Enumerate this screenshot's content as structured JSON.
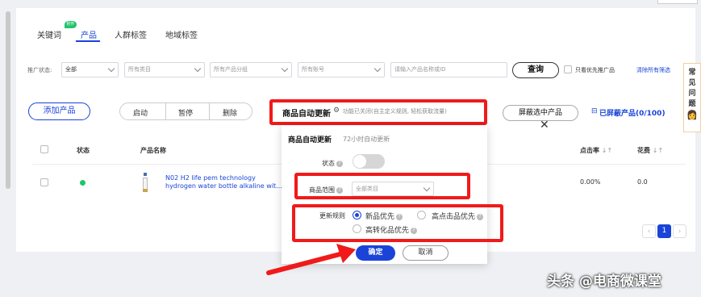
{
  "tabs": [
    {
      "label": "关键词",
      "badge": "附件"
    },
    {
      "label": "产品",
      "active": true
    },
    {
      "label": "人群标签"
    },
    {
      "label": "地域标签"
    }
  ],
  "filters": {
    "status_label": "推广状态:",
    "status_value": "全部",
    "category_placeholder": "所有类目",
    "group_placeholder": "所有产品分组",
    "account_placeholder": "所有账号",
    "search_placeholder": "请输入产品名称或ID",
    "query_button": "查询",
    "priority_only": "只看优先推广品",
    "clear_all": "清除所有筛选"
  },
  "toolbar": {
    "add_product": "添加产品",
    "start": "启动",
    "pause": "暂停",
    "delete": "删除",
    "auto_update_title": "商品自动更新",
    "auto_update_desc": "功能已关闭(自主定义规则, 轻松获取流量)",
    "hide_selected": "屏蔽选中产品",
    "hidden_count": "已屏蔽产品(0/100)"
  },
  "table": {
    "headers": {
      "status": "状态",
      "name": "产品名称",
      "ctr": "点击率",
      "cost": "花费"
    },
    "rows": [
      {
        "name_line1": "N02 H2 life pem technology",
        "name_line2": "hydrogen water bottle alkaline wit...",
        "ctr": "0.00%",
        "cost": "0.0"
      }
    ]
  },
  "popup": {
    "title": "商品自动更新",
    "subtitle": "72小时自动更新",
    "status_label": "状态",
    "scope_label": "商品范围",
    "scope_value": "全部类目",
    "rule_label": "更新规则",
    "rule_options": [
      "新品优先",
      "高点击品优先",
      "高转化品优先"
    ],
    "selected_rule": "新品优先",
    "confirm": "确定",
    "cancel": "取消"
  },
  "side_help": [
    "常",
    "见",
    "问",
    "题"
  ],
  "pagination": {
    "current": "1"
  },
  "watermark": "头条 @电商微课堂",
  "colors": {
    "accent": "#1a44d8",
    "highlight": "#f01a1a",
    "status_dot": "#21c46b"
  }
}
